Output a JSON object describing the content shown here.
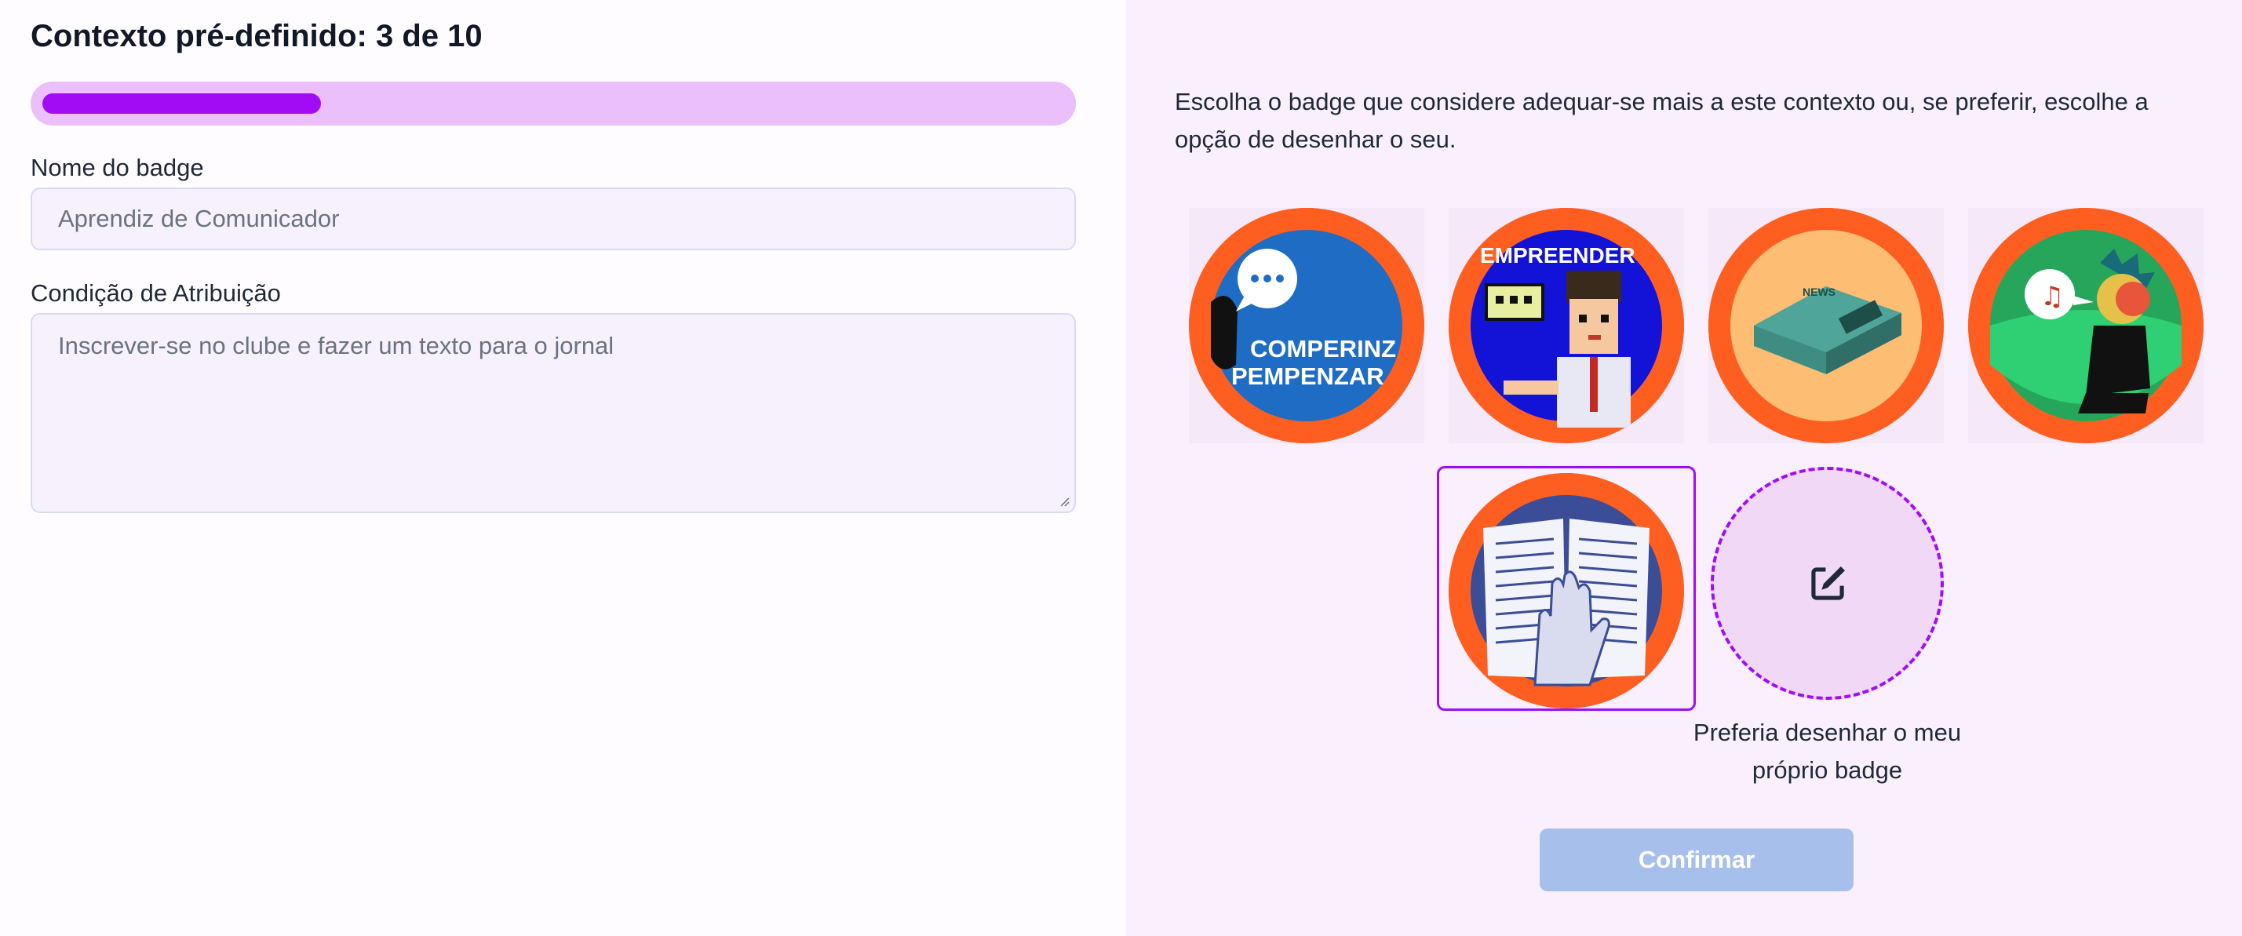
{
  "context": {
    "title": "Contexto pré-definido: 3 de 10",
    "progress_fraction": 0.3
  },
  "form": {
    "name_label": "Nome do badge",
    "name_placeholder": "Aprendiz de Comunicador",
    "condition_label": "Condição de Atribuição",
    "condition_placeholder": "Inscrever-se no clube e fazer um texto para o jornal"
  },
  "picker": {
    "description": "Escolha o badge que considere adequar-se mais a este contexto ou, se preferir, escolhe a opção de desenhar o seu.",
    "badges": [
      {
        "name": "badge-comperinz",
        "text_lines": [
          "COMPERINZ",
          "PEMPENZAR"
        ],
        "icon": "speech-bubble-icon"
      },
      {
        "name": "badge-empreender",
        "text_lines": [
          "EMPREENDER"
        ],
        "icon": "pixel-person-icon"
      },
      {
        "name": "badge-newspaper",
        "text_lines": [
          "NEWS"
        ],
        "icon": "newspaper-icon"
      },
      {
        "name": "badge-music",
        "text_lines": [],
        "icon": "music-note-icon"
      },
      {
        "name": "badge-reading-book",
        "text_lines": [],
        "icon": "open-book-icon",
        "selected": true
      }
    ],
    "draw_option_label": "Preferia desenhar o meu próprio badge",
    "draw_icon": "edit-pencil-icon",
    "confirm_label": "Confirmar"
  },
  "colors": {
    "accent": "#a10cf5",
    "badge_ring": "#fe5f21",
    "confirm_disabled": "#a7c0eb",
    "right_panel_bg": "#f9effd"
  }
}
